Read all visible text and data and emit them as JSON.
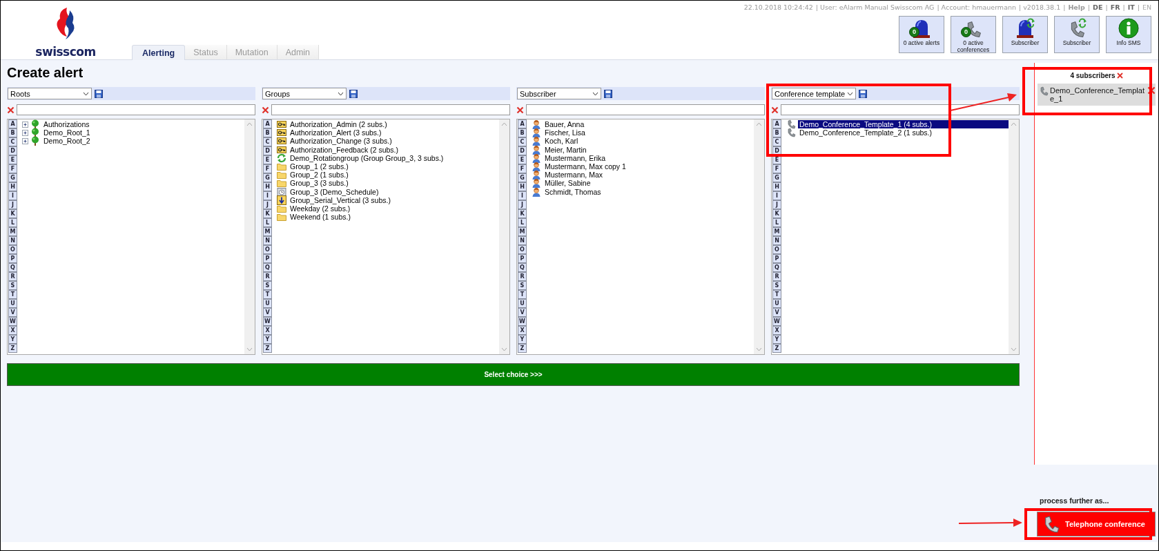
{
  "header": {
    "logo_text": "swisscom",
    "meta": [
      {
        "kind": "info",
        "text": "22.10.2018 10:24:42"
      },
      {
        "kind": "info",
        "text": "| User: eAlarm Manual Swisscom AG"
      },
      {
        "kind": "info",
        "text": "| Account: hmauermann"
      },
      {
        "kind": "info",
        "text": "| v2018.38.1"
      },
      {
        "kind": "sep",
        "text": "|"
      },
      {
        "kind": "link",
        "text": "Help"
      },
      {
        "kind": "sep",
        "text": "|"
      },
      {
        "kind": "lang",
        "text": "DE",
        "selected": false
      },
      {
        "kind": "sep",
        "text": "|"
      },
      {
        "kind": "lang",
        "text": "FR",
        "selected": false
      },
      {
        "kind": "sep",
        "text": "|"
      },
      {
        "kind": "lang",
        "text": "IT",
        "selected": false
      },
      {
        "kind": "sep",
        "text": "|"
      },
      {
        "kind": "lang",
        "text": "EN",
        "selected": true
      }
    ],
    "toolbar": [
      {
        "kind": "alerts",
        "badge": "0",
        "label": "0 active alerts"
      },
      {
        "kind": "conferences",
        "badge": "0",
        "label": "0 active conferences"
      },
      {
        "kind": "subscriber-alarm",
        "label": "Subscriber"
      },
      {
        "kind": "subscriber-phone",
        "label": "Subscriber"
      },
      {
        "kind": "info",
        "label": "Info SMS"
      }
    ],
    "tabs": [
      {
        "label": "Alerting",
        "selected": true
      },
      {
        "label": "Status",
        "selected": false
      },
      {
        "label": "Mutation",
        "selected": false
      },
      {
        "label": "Admin",
        "selected": false
      }
    ]
  },
  "title": "Create alert",
  "columns": [
    {
      "dropdown": "Roots",
      "letters": [
        "A",
        "B",
        "C",
        "D",
        "E",
        "F",
        "G",
        "H",
        "I",
        "J",
        "K",
        "L",
        "M",
        "N",
        "O",
        "P",
        "Q",
        "R",
        "S",
        "T",
        "U",
        "V",
        "W",
        "X",
        "Y",
        "Z"
      ],
      "items": [
        {
          "kind": "tree",
          "label": "Authorizations",
          "expanded": false,
          "selected": false
        },
        {
          "kind": "tree",
          "label": "Demo_Root_1",
          "expanded": false,
          "selected": false
        },
        {
          "kind": "tree",
          "label": "Demo_Root_2",
          "expanded": false,
          "selected": false
        }
      ]
    },
    {
      "dropdown": "Groups",
      "letters": [
        "A",
        "B",
        "C",
        "D",
        "E",
        "F",
        "G",
        "H",
        "I",
        "J",
        "K",
        "L",
        "M",
        "N",
        "O",
        "P",
        "Q",
        "R",
        "S",
        "T",
        "U",
        "V",
        "W",
        "X",
        "Y",
        "Z"
      ],
      "items": [
        {
          "kind": "key",
          "label": "Authorization_Admin (2 subs.)",
          "selected": false
        },
        {
          "kind": "key",
          "label": "Authorization_Alert (3 subs.)",
          "selected": false
        },
        {
          "kind": "key",
          "label": "Authorization_Change (3 subs.)",
          "selected": false
        },
        {
          "kind": "key",
          "label": "Authorization_Feedback (2 subs.)",
          "selected": false
        },
        {
          "kind": "rotation",
          "label": "Demo_Rotationgroup (Group Group_3, 3 subs.)",
          "selected": false
        },
        {
          "kind": "folder",
          "label": "Group_1 (2 subs.)",
          "selected": false
        },
        {
          "kind": "folder",
          "label": "Group_2 (1 subs.)",
          "selected": false
        },
        {
          "kind": "folder",
          "label": "Group_3 (3 subs.)",
          "selected": false
        },
        {
          "kind": "schedule",
          "label": "Group_3 (Demo_Schedule)",
          "selected": false
        },
        {
          "kind": "serial",
          "label": "Group_Serial_Vertical (3 subs.)",
          "selected": false
        },
        {
          "kind": "folder",
          "label": "Weekday (2 subs.)",
          "selected": false
        },
        {
          "kind": "folder",
          "label": "Weekend (1 subs.)",
          "selected": false
        }
      ]
    },
    {
      "dropdown": "Subscriber",
      "letters": [
        "A",
        "B",
        "C",
        "D",
        "E",
        "F",
        "G",
        "H",
        "I",
        "J",
        "K",
        "L",
        "M",
        "N",
        "O",
        "P",
        "Q",
        "R",
        "S",
        "T",
        "U",
        "V",
        "W",
        "X",
        "Y",
        "Z"
      ],
      "items": [
        {
          "kind": "person",
          "label": "Bauer, Anna",
          "selected": false
        },
        {
          "kind": "person",
          "label": "Fischer, Lisa",
          "selected": false
        },
        {
          "kind": "person",
          "label": "Koch, Karl",
          "selected": false
        },
        {
          "kind": "person",
          "label": "Meier, Martin",
          "selected": false
        },
        {
          "kind": "person",
          "label": "Mustermann, Erika",
          "selected": false
        },
        {
          "kind": "person",
          "label": "Mustermann, Max copy 1",
          "selected": false
        },
        {
          "kind": "person",
          "label": "Mustermann, Max",
          "selected": false
        },
        {
          "kind": "person",
          "label": "Müller, Sabine",
          "selected": false
        },
        {
          "kind": "person",
          "label": "Schmidt, Thomas",
          "selected": false
        }
      ]
    },
    {
      "dropdown": "Conference template",
      "letters": [
        "A",
        "B",
        "C",
        "D",
        "E",
        "F",
        "G",
        "H",
        "I",
        "J",
        "K",
        "L",
        "M",
        "N",
        "O",
        "P",
        "Q",
        "R",
        "S",
        "T",
        "U",
        "V",
        "W",
        "X",
        "Y",
        "Z"
      ],
      "items": [
        {
          "kind": "phone",
          "label": "Demo_Conference_Template_1 (4 subs.)",
          "selected": true
        },
        {
          "kind": "phone",
          "label": "Demo_Conference_Template_2 (1 subs.)",
          "selected": false
        }
      ]
    }
  ],
  "select_button": "Select choice >>>",
  "selection_panel": {
    "heading": "4 subscribers",
    "items": [
      {
        "kind": "phone",
        "label": "Demo_Conference_Template_1"
      }
    ],
    "process_label": "process further as...",
    "action": {
      "kind": "phone",
      "label": "Telephone conference"
    }
  }
}
